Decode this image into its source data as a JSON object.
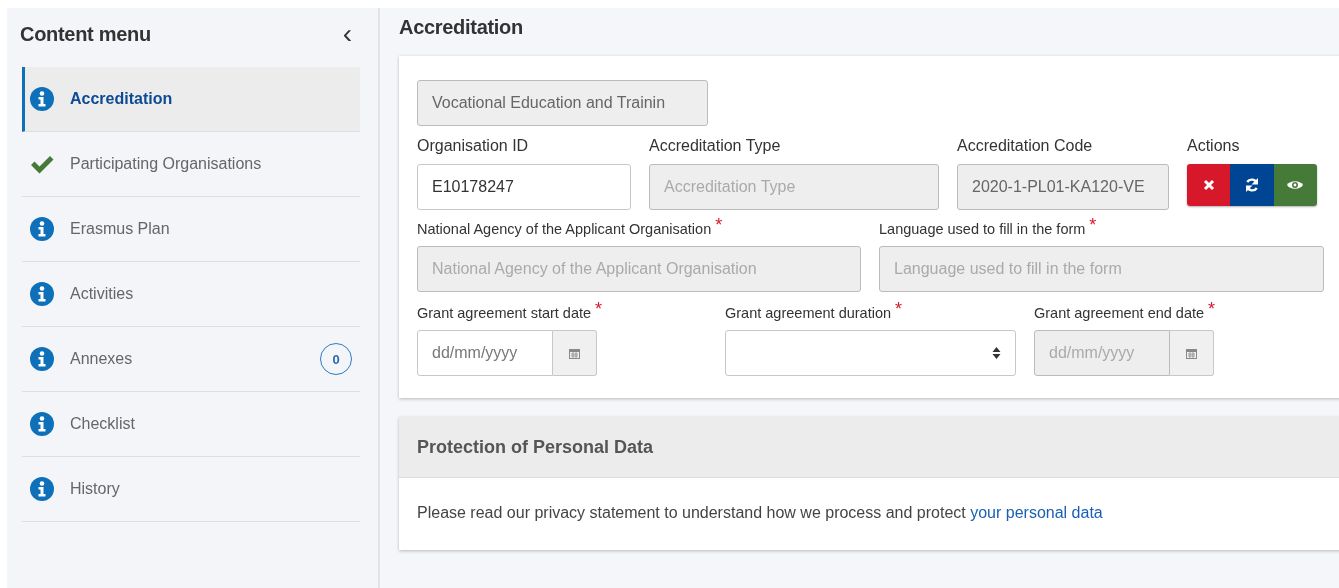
{
  "sidebar": {
    "title": "Content menu",
    "collapse_icon": "‹",
    "items": [
      {
        "label": "Accreditation",
        "kind": "info",
        "selected": true
      },
      {
        "label": "Participating Organisations",
        "kind": "check",
        "selected": false
      },
      {
        "label": "Erasmus Plan",
        "kind": "info",
        "selected": false
      },
      {
        "label": "Activities",
        "kind": "info",
        "selected": false
      },
      {
        "label": "Annexes",
        "kind": "info",
        "selected": false,
        "badge": "0"
      },
      {
        "label": "Checklist",
        "kind": "info",
        "selected": false
      },
      {
        "label": "History",
        "kind": "info",
        "selected": false
      }
    ]
  },
  "page_title": "Accreditation",
  "form": {
    "top_field": {
      "value": "Vocational Education and Trainin",
      "disabled": true
    },
    "rows": [
      [
        {
          "kind": "text",
          "label": "Organisation ID",
          "value": "E10178247",
          "disabled": false
        },
        {
          "kind": "text",
          "label": "Accreditation Type",
          "placeholder": "Accreditation Type",
          "disabled": true
        },
        {
          "kind": "text",
          "label": "Accreditation Code",
          "value": "2020-1-PL01-KA120-VE",
          "disabled": true
        },
        {
          "kind": "actions",
          "label": "Actions",
          "buttons": [
            {
              "kind": "delete"
            },
            {
              "kind": "refresh"
            },
            {
              "kind": "view"
            }
          ]
        }
      ],
      [
        {
          "kind": "text",
          "label": "National Agency of the Applicant Organisation",
          "placeholder": "National Agency of the Applicant Organisation",
          "disabled": true,
          "required_mark": "*"
        },
        {
          "kind": "text",
          "label": "Language used to fill in the form",
          "placeholder": "Language used to fill in the form",
          "disabled": true,
          "required_mark": "*"
        }
      ],
      [
        {
          "kind": "date",
          "label": "Grant agreement start date",
          "placeholder": "dd/mm/yyyy",
          "disabled": false,
          "required_mark": "*"
        },
        {
          "kind": "select",
          "label": "Grant agreement duration",
          "disabled": false,
          "required_mark": "*"
        },
        {
          "kind": "date",
          "label": "Grant agreement end date",
          "placeholder": "dd/mm/yyyy",
          "disabled": true,
          "required_mark": "*"
        }
      ]
    ]
  },
  "privacy": {
    "title": "Protection of Personal Data",
    "text": "Please read our privacy statement to understand how we process and protect",
    "link": "your personal data"
  }
}
